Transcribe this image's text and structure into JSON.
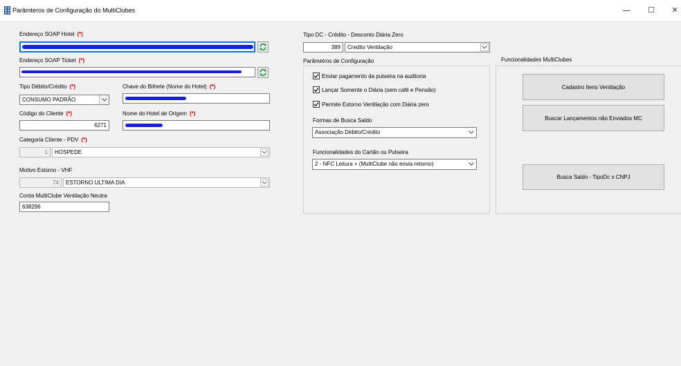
{
  "window": {
    "title": "Parâmteros de Configuração do MultiClubes",
    "minimize": "—",
    "maximize": "☐",
    "close": "✕"
  },
  "left": {
    "soap_hotel": {
      "label": "Endereço SOAP Hotel",
      "req": "(*)"
    },
    "soap_ticket": {
      "label": "Endereço SOAP Ticket",
      "req": "(*)"
    },
    "tipo_debito": {
      "label": "Tipo Débito/Crédito",
      "req": "(*)",
      "value": "CONSUMO PADRÃO"
    },
    "chave_bilhete": {
      "label": "Chave do Bilhete (Nome do Hotel)",
      "req": "(*)"
    },
    "codigo_cliente": {
      "label": "Código do Cliente",
      "req": "(*)",
      "value": "6271"
    },
    "nome_hotel": {
      "label": "Nome do Hotel de Origem",
      "req": "(*)"
    },
    "categoria": {
      "label": "Categoria Cliente - PDV",
      "req": "(*)",
      "code": "1",
      "value": "HOSPEDE"
    },
    "motivo": {
      "label": "Motivo Estorno - VHF",
      "code": "74",
      "value": "ESTORNO ULTIMA DIA"
    },
    "conta": {
      "label": "Conta MultiClube Ventilação Neutra",
      "value": "638296"
    }
  },
  "middle": {
    "tipo_dc": {
      "label": "Tipo DC - Crédito - Desconto Diária Zero",
      "code": "389",
      "value": "Credito Ventilação"
    },
    "params": {
      "title": "Parâmetros de Configuração",
      "check1": "Enviar pagamento da pulseira na auditoria",
      "check2": "Lançar Somente o Diária (sem café e Pensão)",
      "check3": "Permite Estorno Ventilação com Diária zero",
      "formas": {
        "label": "Formas de Busca Saldo",
        "value": "Associação Débito/Crédito"
      },
      "func_cartao": {
        "label": "Funcionalidades do Cartão ou Pulseira",
        "value": "2 - NFC Leitura + (MultiClube não envia retorno)"
      }
    }
  },
  "right": {
    "title": "Funcionalidades MultiClubes",
    "btn1": "Cadastro Itens Ventilação",
    "btn2": "Buscar Lançamentos não Enviados MC",
    "btn3": "Busca Saldo - TipoDc x CNPJ"
  },
  "colors": {
    "required": "#d40000",
    "scribble": "#1a1fd9",
    "refresh": "#2e9e52"
  }
}
